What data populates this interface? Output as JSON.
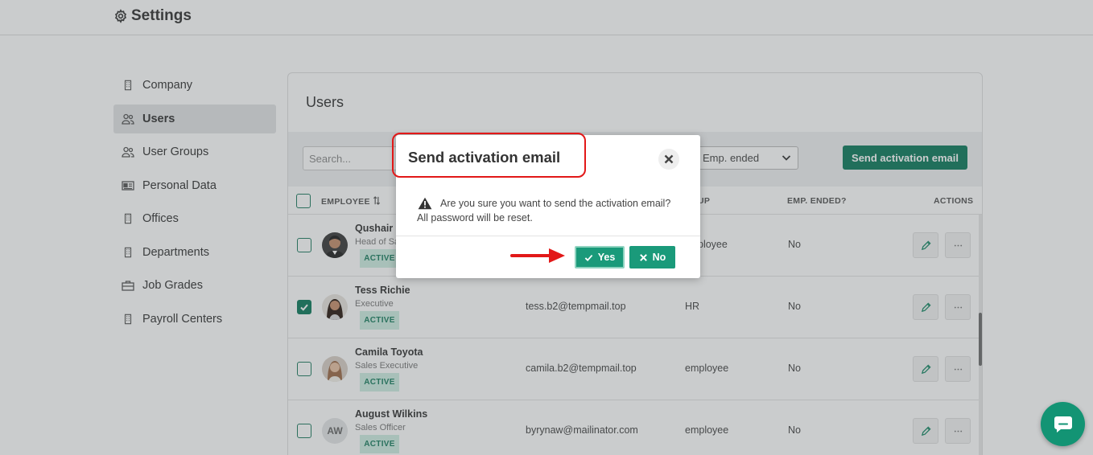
{
  "header": {
    "title": "Settings",
    "icon": "gear-icon"
  },
  "sidebar": {
    "items": [
      {
        "label": "Company",
        "icon": "building-icon"
      },
      {
        "label": "Users",
        "icon": "users-icon",
        "active": true
      },
      {
        "label": "User Groups",
        "icon": "users-icon"
      },
      {
        "label": "Personal Data",
        "icon": "id-card-icon"
      },
      {
        "label": "Offices",
        "icon": "building-icon"
      },
      {
        "label": "Departments",
        "icon": "building-icon"
      },
      {
        "label": "Job Grades",
        "icon": "briefcase-icon"
      },
      {
        "label": "Payroll Centers",
        "icon": "building-icon"
      }
    ]
  },
  "main": {
    "title": "Users",
    "search_placeholder": "Search...",
    "filter_value": "Emp. ended",
    "send_button": "Send activation email",
    "columns": {
      "employee": "EMPLOYEE",
      "group": "UP",
      "emp_ended": "EMP. ENDED?",
      "actions": "ACTIONS"
    },
    "rows": [
      {
        "name": "Qushair I",
        "title": "Head of Sa",
        "status": "ACTIVE",
        "email": "",
        "group": "ployee",
        "emp_ended": "No",
        "checked": false
      },
      {
        "name": "Tess Richie",
        "title": "Executive",
        "status": "ACTIVE",
        "email": "tess.b2@tempmail.top",
        "group": "HR",
        "emp_ended": "No",
        "checked": true
      },
      {
        "name": "Camila Toyota",
        "title": "Sales Executive",
        "status": "ACTIVE",
        "email": "camila.b2@tempmail.top",
        "group": "employee",
        "emp_ended": "No",
        "checked": false
      },
      {
        "name": "August Wilkins",
        "title": "Sales Officer",
        "status": "ACTIVE",
        "email": "byrynaw@mailinator.com",
        "group": "employee",
        "emp_ended": "No",
        "checked": false,
        "initials": "AW"
      }
    ]
  },
  "dialog": {
    "title": "Send activation email",
    "message_line1": "Are you sure you want to send the activation email?",
    "message_line2": "All password will be reset.",
    "yes_label": "Yes",
    "no_label": "No"
  },
  "colors": {
    "accent": "#0e7a5c",
    "dialog_button": "#1a9a7a",
    "badge_bg": "#cfeee2",
    "annotation": "#e21818"
  }
}
